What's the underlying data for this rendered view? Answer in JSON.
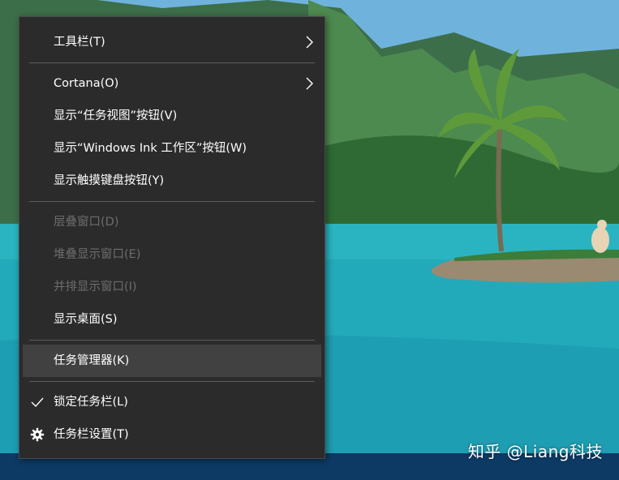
{
  "menu": {
    "items": [
      {
        "label": "工具栏(T)"
      },
      {
        "label": "Cortana(O)"
      },
      {
        "label": "显示“任务视图”按钮(V)"
      },
      {
        "label": "显示“Windows Ink 工作区”按钮(W)"
      },
      {
        "label": "显示触摸键盘按钮(Y)"
      },
      {
        "label": "层叠窗口(D)",
        "state": "disabled"
      },
      {
        "label": "堆叠显示窗口(E)",
        "state": "disabled"
      },
      {
        "label": "并排显示窗口(I)",
        "state": "disabled"
      },
      {
        "label": "显示桌面(S)"
      },
      {
        "label": "任务管理器(K)",
        "state": "hovered"
      },
      {
        "label": "锁定任务栏(L)",
        "icon": "checkmark-icon"
      },
      {
        "label": "任务栏设置(T)",
        "icon": "gear-icon"
      }
    ]
  },
  "watermark": "知乎 @Liang科技",
  "colors": {
    "menu_bg": "#2b2b2b",
    "hover_bg": "#414141",
    "text": "#ffffff",
    "disabled_text": "#6d6d6d",
    "separator": "#5c5c5c",
    "taskbar": "#0d3a64"
  }
}
